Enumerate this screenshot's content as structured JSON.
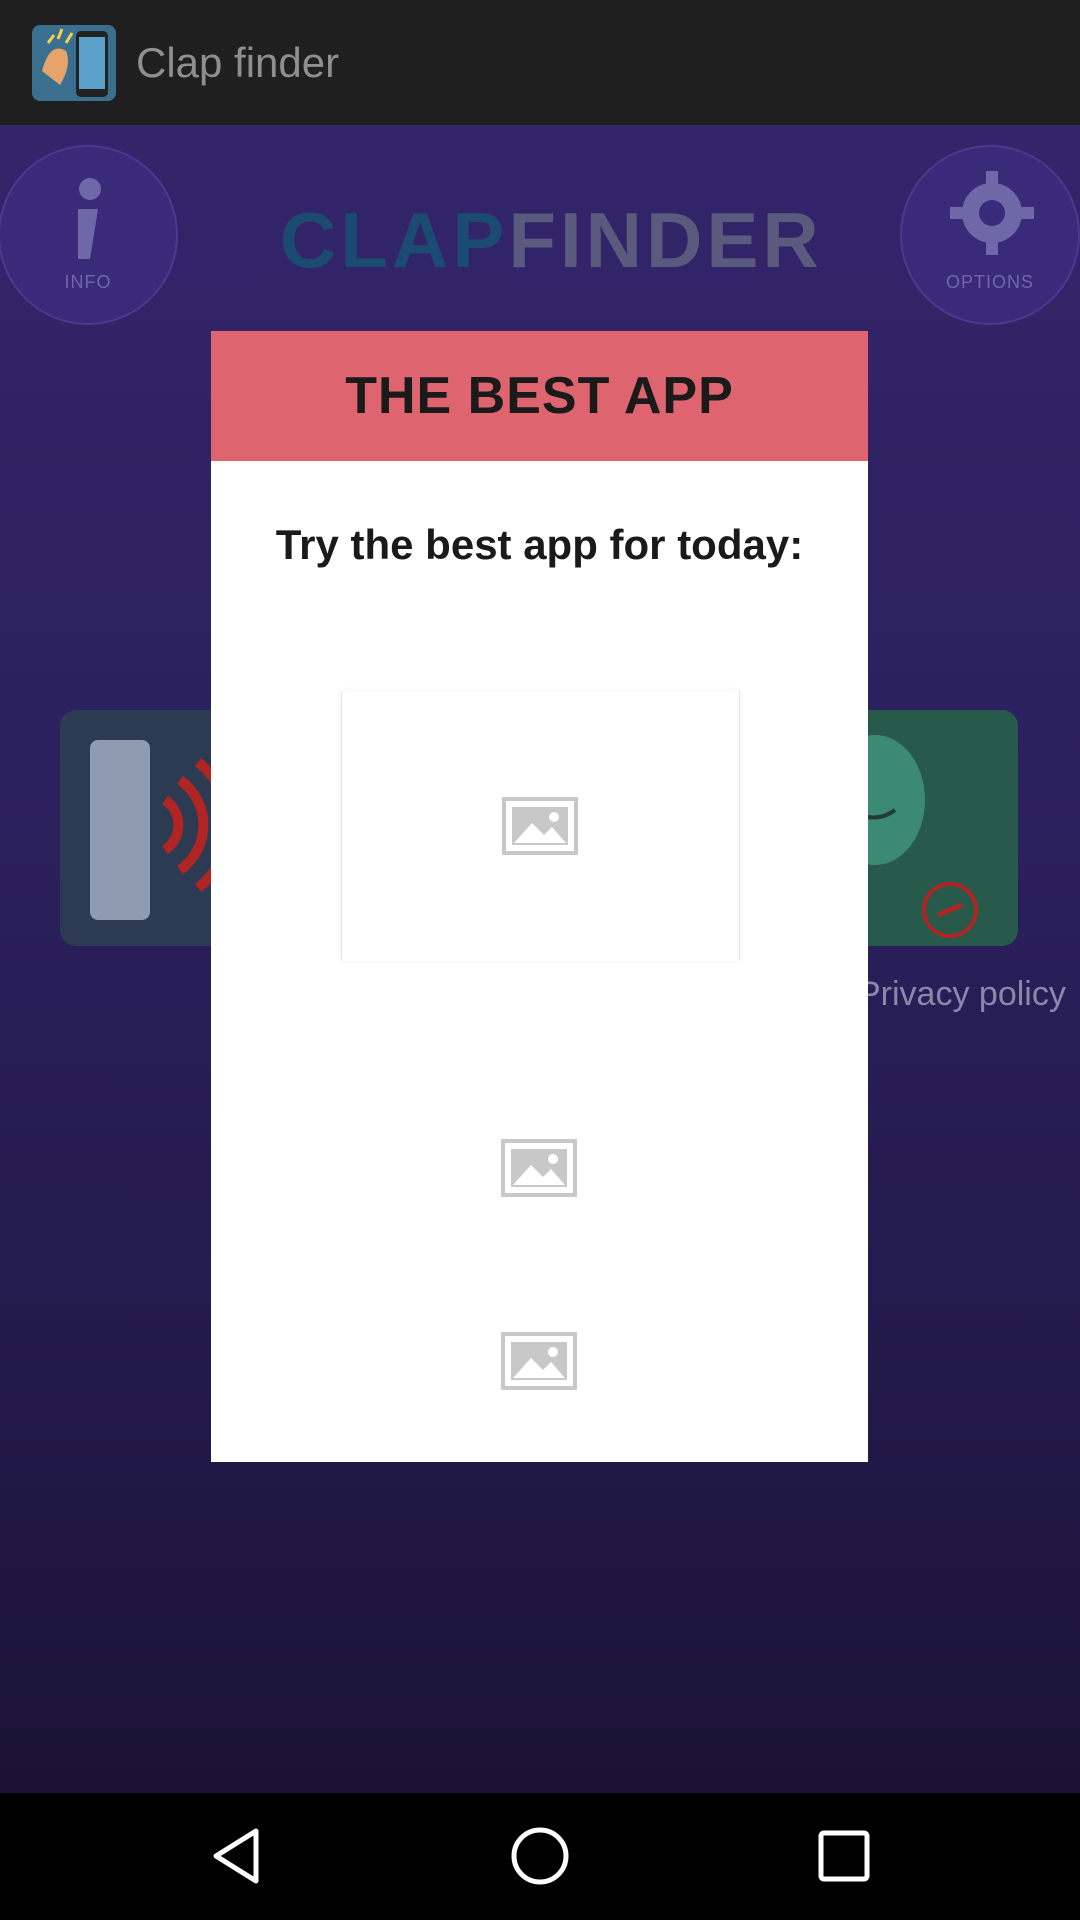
{
  "appbar": {
    "title": "Clap finder",
    "icon": "clap-app-icon"
  },
  "background": {
    "logo_part1": "CLAP",
    "logo_part2": "FINDER",
    "info_label": "INFO",
    "options_label": "OPTIONS",
    "privacy_link": "Privacy policy"
  },
  "dialog": {
    "title": "THE BEST APP",
    "subtitle": "Try the best app for today:",
    "image_placeholders": [
      "image-placeholder-icon",
      "image-placeholder-icon",
      "image-placeholder-icon"
    ]
  },
  "navbar": {
    "back": "back-triangle-icon",
    "home": "home-circle-icon",
    "recents": "recents-square-icon"
  },
  "colors": {
    "dialog_header": "#de6570",
    "background": "#2c2160",
    "appbar": "#1f1f1f"
  }
}
